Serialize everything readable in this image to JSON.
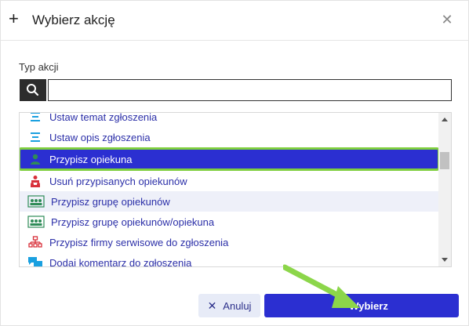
{
  "dialog": {
    "title": "Wybierz akcję",
    "plus_icon": "+",
    "close_icon": "✕"
  },
  "field": {
    "label": "Typ akcji",
    "value": "",
    "placeholder": ""
  },
  "list": {
    "items": [
      {
        "label": "Ustaw temat zgłoszenia",
        "icon": "lines-icon",
        "state": "partial"
      },
      {
        "label": "Ustaw opis zgłoszenia",
        "icon": "lines-icon",
        "state": "normal"
      },
      {
        "label": "Przypisz opiekuna",
        "icon": "person-icon",
        "state": "selected"
      },
      {
        "label": "Usuń przypisanych opiekunów",
        "icon": "people-remove-icon",
        "state": "normal"
      },
      {
        "label": "Przypisz grupę opiekunów",
        "icon": "group-icon",
        "state": "hover"
      },
      {
        "label": "Przypisz grupę opiekunów/opiekuna",
        "icon": "group-icon",
        "state": "normal"
      },
      {
        "label": "Przypisz firmy serwisowe do zgłoszenia",
        "icon": "org-chart-icon",
        "state": "normal"
      },
      {
        "label": "Dodaj komentarz do zgłoszenia",
        "icon": "comments-icon",
        "state": "normal"
      }
    ]
  },
  "buttons": {
    "cancel": "Anuluj",
    "select": "Wybierz"
  },
  "colors": {
    "primary": "#2b2fd1",
    "highlight_border": "#7fcf3e",
    "hover_row": "#eef0f9",
    "cancel_bg": "#e7ebf7",
    "icon_cyan": "#1aa0e0",
    "icon_green": "#2e8b57",
    "icon_red": "#d8303a"
  }
}
